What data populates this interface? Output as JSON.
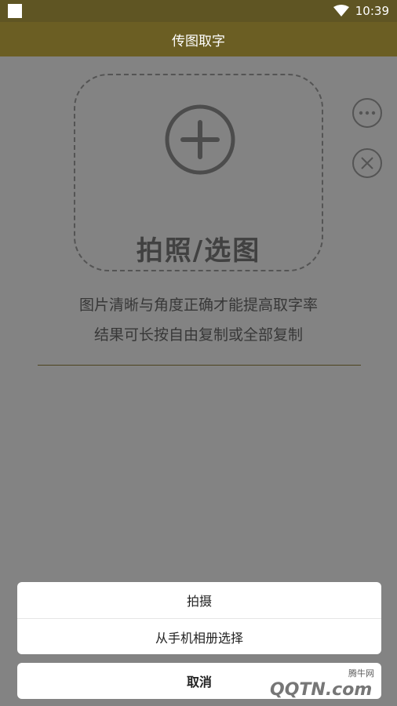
{
  "status_bar": {
    "time": "10:39"
  },
  "app_bar": {
    "title": "传图取字"
  },
  "upload": {
    "label": "拍照/选图"
  },
  "tips": {
    "line1": "图片清晰与角度正确才能提高取字率",
    "line2": "结果可长按自由复制或全部复制"
  },
  "action_sheet": {
    "items": [
      {
        "label": "拍摄"
      },
      {
        "label": "从手机相册选择"
      }
    ],
    "cancel_label": "取消"
  },
  "watermark": {
    "text1": "腾牛网",
    "text2": "QQTN.com"
  },
  "colors": {
    "app_bar": "#6b5e23",
    "divider": "#8c7a3a"
  }
}
